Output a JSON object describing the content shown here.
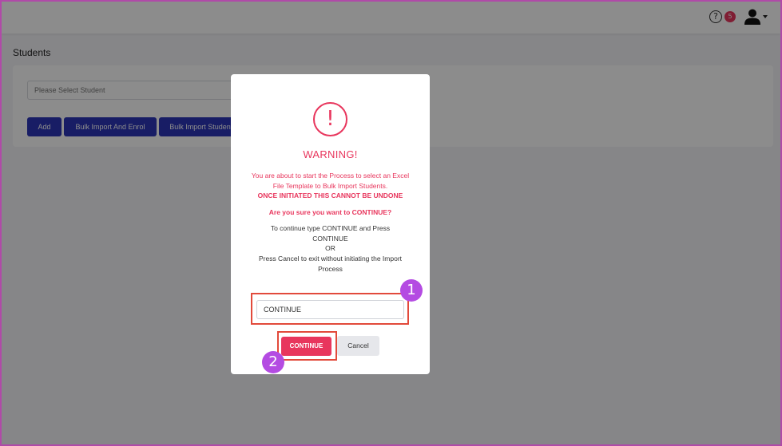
{
  "header": {
    "help_icon_glyph": "?",
    "notification_count": "5"
  },
  "page": {
    "title": "Students"
  },
  "student_select": {
    "placeholder": "Please Select Student"
  },
  "toolbar": {
    "add_label": "Add",
    "bulk_import_enrol_label": "Bulk Import And Enrol",
    "bulk_import_students_label": "Bulk Import Students"
  },
  "modal": {
    "icon_glyph": "!",
    "title": "WARNING!",
    "line1": "You are about to start the Process to select an Excel File Template to Bulk Import Students.",
    "line2": "ONCE INITIATED THIS CANNOT BE UNDONE",
    "question": "Are you sure you want to CONTINUE?",
    "instruction1": "To continue type CONTINUE and Press CONTINUE",
    "or": "OR",
    "instruction2": "Press Cancel to exit without initiating the Import Process",
    "input_value": "CONTINUE",
    "continue_label": "CONTINUE",
    "cancel_label": "Cancel"
  },
  "annotations": {
    "step1": "1",
    "step2": "2"
  },
  "colors": {
    "accent_pink": "#e8365d",
    "primary_blue": "#2d36b8",
    "step_badge": "#b44be2",
    "highlight_border": "#e24a3b"
  }
}
